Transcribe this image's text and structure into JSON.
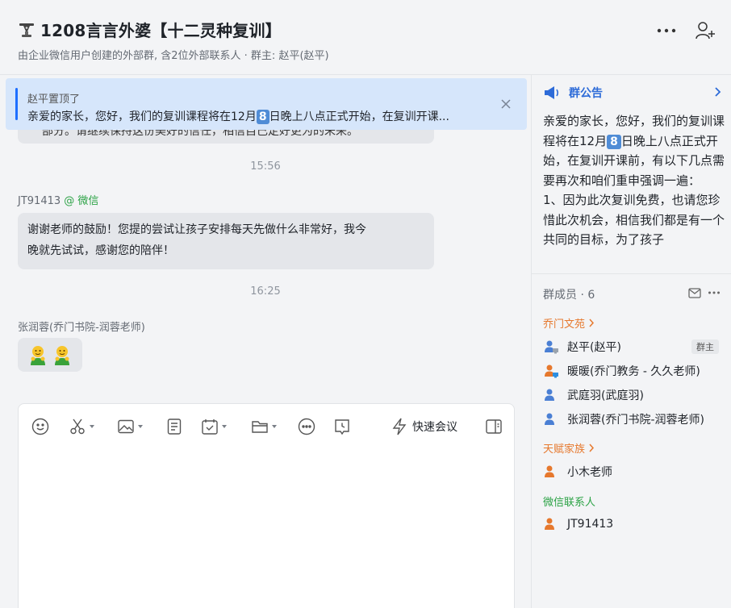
{
  "header": {
    "title": "1208言言外婆【十二灵种复训】",
    "subtitle": "由企业微信用户创建的外部群, 含2位外部联系人 · 群主: 赵平(赵平)"
  },
  "pinned": {
    "by": "赵平置顶了",
    "text_a": "亲爱的家长，您好，我们的复训课程将在12月",
    "badge": "8",
    "text_b": "日晚上八点正式开始，在复训开课..."
  },
  "messages": {
    "partial_text": "部分。请继续保持这份美好的信任，相信自己定好更为的未来。",
    "time1": "15:56",
    "sender1": "JT91413",
    "sender1_source": "@ 微信",
    "msg1_line1": "谢谢老师的鼓励！您提的尝试让孩子安排每天先做什么非常好，我今",
    "msg1_line2": "晚就先试试，感谢您的陪伴！",
    "time2": "16:25",
    "sender2": "张润蓉(乔门书院-润蓉老师)"
  },
  "composer": {
    "quick_meeting": "快速会议"
  },
  "announcement": {
    "title": "群公告",
    "body_a": "亲爱的家长，您好，我们的复训课程将在12月",
    "badge": "8",
    "body_b": "日晚上八点正式开始，在复训开课前，有以下几点需要再次和咱们重申强调一遍：",
    "body_c": "1、因为此次复训免费，也请您珍惜此次机会，相信我们都是有一个共同的目标，为了孩子"
  },
  "members": {
    "title": "群成员 · 6",
    "groups": [
      {
        "label": "乔门文苑",
        "items": [
          {
            "name": "赵平(赵平)",
            "badge": "群主"
          },
          {
            "name": "暖暖(乔门教务 - 久久老师)"
          },
          {
            "name": "武庭羽(武庭羽)"
          },
          {
            "name": "张润蓉(乔门书院-润蓉老师)"
          }
        ]
      },
      {
        "label": "天赋家族",
        "items": [
          {
            "name": "小木老师"
          }
        ]
      },
      {
        "label": "微信联系人",
        "items": [
          {
            "name": "JT91413"
          }
        ]
      }
    ]
  },
  "colors": {
    "accent": "#2d6bd8",
    "wechat_green": "#2ba245",
    "external_orange": "#e6782d",
    "pinned_bg": "#d6e6fb"
  }
}
